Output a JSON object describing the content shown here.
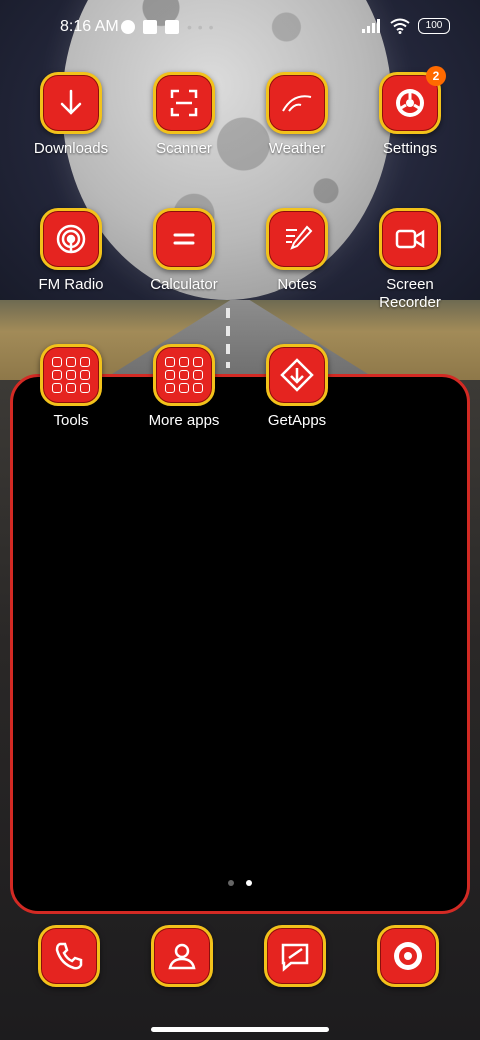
{
  "status_bar": {
    "time": "8:16 AM",
    "battery": "100",
    "left_icons": [
      "app-notification-icon",
      "square-notification-icon",
      "alert-notification-icon"
    ],
    "right_icons": [
      "signal-icon",
      "wifi-icon",
      "battery-icon"
    ],
    "overflow_dots": "• • •"
  },
  "colors": {
    "icon_fill": "#e52420",
    "icon_border": "#f2c21b",
    "widget_border": "#d32a24",
    "badge": "#ff6a00"
  },
  "apps": {
    "downloads": {
      "label": "Downloads",
      "icon": "download-arrow-icon"
    },
    "scanner": {
      "label": "Scanner",
      "icon": "scan-frame-icon"
    },
    "weather": {
      "label": "Weather",
      "icon": "weather-curve-icon"
    },
    "settings": {
      "label": "Settings",
      "icon": "gear-icon",
      "badge": "2"
    },
    "fm_radio": {
      "label": "FM Radio",
      "icon": "radio-broadcast-icon"
    },
    "calculator": {
      "label": "Calculator",
      "icon": "equals-icon"
    },
    "notes": {
      "label": "Notes",
      "icon": "pencil-note-icon"
    },
    "screen_recorder": {
      "label": "Screen Recorder",
      "icon": "video-camera-icon"
    },
    "tools": {
      "label": "Tools",
      "icon": "folder-grid-icon"
    },
    "more_apps": {
      "label": "More apps",
      "icon": "folder-grid-icon"
    },
    "getapps": {
      "label": "GetApps",
      "icon": "store-arrow-icon"
    }
  },
  "dock": {
    "phone": {
      "icon": "phone-icon"
    },
    "contacts": {
      "icon": "contact-person-icon"
    },
    "messages": {
      "icon": "message-bubble-icon"
    },
    "camera": {
      "icon": "camera-lens-icon"
    }
  },
  "pager": {
    "pages": 2,
    "current": 2
  }
}
